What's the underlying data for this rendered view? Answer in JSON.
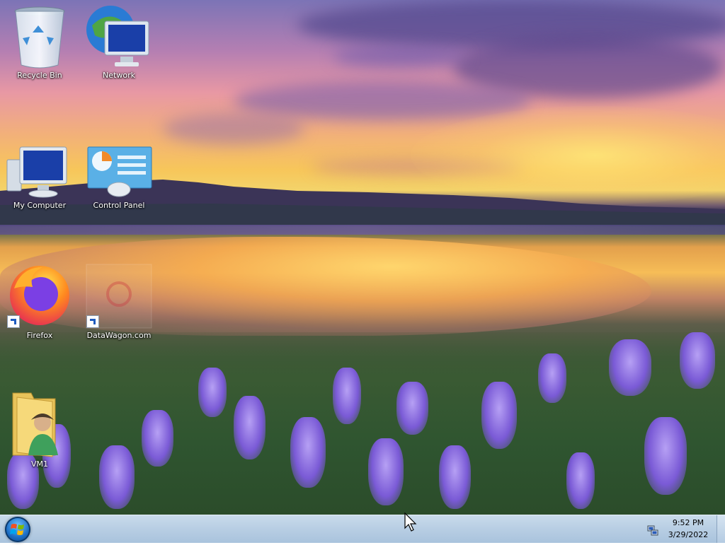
{
  "desktop": {
    "icons": [
      {
        "label": "Recycle Bin",
        "icon": "recycle-bin-icon"
      },
      {
        "label": "Network",
        "icon": "network-icon"
      },
      {
        "label": "My Computer",
        "icon": "computer-icon"
      },
      {
        "label": "Control Panel",
        "icon": "control-panel-icon"
      },
      {
        "label": "Firefox",
        "icon": "firefox-icon"
      },
      {
        "label": "DataWagon.com",
        "icon": "web-shortcut-icon"
      },
      {
        "label": "VM1",
        "icon": "user-folder-icon"
      }
    ]
  },
  "taskbar": {
    "start_icon": "windows-logo-icon",
    "tray_icon": "network-tray-icon",
    "clock_time": "9:52 PM",
    "clock_date": "3/29/2022"
  },
  "colors": {
    "taskbar": "#b9cfe4",
    "start_orb": "#1d6fc7"
  }
}
